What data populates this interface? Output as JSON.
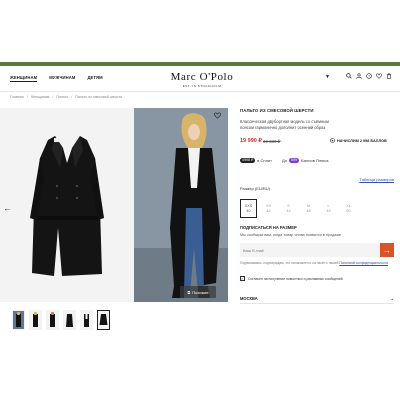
{
  "header": {
    "nav": [
      "ЖЕНЩИНАМ",
      "МУЖЧИНАМ",
      "ДЕТЯМ"
    ],
    "logo_name": "Marc O'Polo",
    "logo_sub": "EST. IN STOCKHOLM"
  },
  "breadcrumb": [
    "Главная",
    "Женщинам",
    "Пальто",
    "Пальто из смесовой шерсти"
  ],
  "gallery": {
    "similar_label": "Похожие"
  },
  "product": {
    "title": "ПАЛЬТО ИЗ СМЕСОВОЙ ШЕРСТИ",
    "description": "Классическая двубортная модель со съёмным поясом гармонично дополнит осенний образ",
    "price": "19 990 ₽",
    "old_price": "39 980 ₽",
    "bonus": "НАЧИСЛИМ 2 998 БАЛЛОВ",
    "split_amount": "4998 ₽",
    "split_text": "в Сплит",
    "plus_prefix": "До",
    "plus_amount": "599",
    "plus_text": "Баллов Плюса",
    "size_label": "Размер (EU/RU)",
    "size_table_link": "Таблица размеров",
    "sizes": [
      {
        "eu": "XXS",
        "ru": "40"
      },
      {
        "eu": "XS",
        "ru": "42"
      },
      {
        "eu": "S",
        "ru": "44"
      },
      {
        "eu": "M",
        "ru": "46"
      },
      {
        "eu": "L",
        "ru": "48"
      },
      {
        "eu": "XL",
        "ru": "50"
      }
    ]
  },
  "subscribe": {
    "title": "ПОДПИСАТЬСЯ НА РАЗМЕР",
    "description": "Мы сообщим вам, когда товар снова появится в продаже",
    "email_placeholder": "Ваш E-mail",
    "fine_print": "Подписываясь, подтверждаю, что ознакомлен и согласен с нашей",
    "fine_link": "Политикой конфиденциальности",
    "agree_text": "Согласен на получение новостных и рекламных сообщений"
  },
  "store": {
    "city": "МОСКВА"
  }
}
